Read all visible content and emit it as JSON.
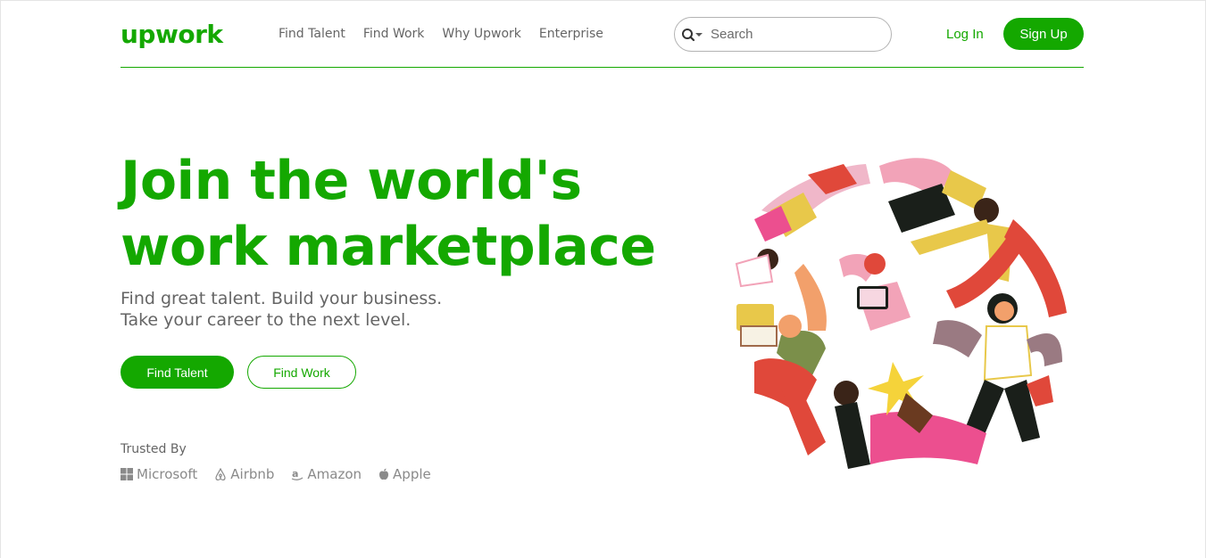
{
  "header": {
    "logo": "upwork",
    "nav": [
      "Find Talent",
      "Find Work",
      "Why Upwork",
      "Enterprise"
    ],
    "search_placeholder": "Search",
    "login": "Log In",
    "signup": "Sign Up"
  },
  "hero": {
    "title_line1": "Join the world's",
    "title_line2": "work marketplace",
    "sub_line1": "Find great talent. Build your business.",
    "sub_line2": "Take your career to the next level.",
    "cta_primary": "Find Talent",
    "cta_secondary": "Find Work"
  },
  "trusted": {
    "label": "Trusted By",
    "brands": [
      {
        "name": "Microsoft",
        "icon": "microsoft-icon"
      },
      {
        "name": "Airbnb",
        "icon": "airbnb-icon"
      },
      {
        "name": "Amazon",
        "icon": "amazon-icon"
      },
      {
        "name": "Apple",
        "icon": "apple-icon"
      }
    ]
  },
  "colors": {
    "brand_green": "#14a800",
    "text_gray": "#656565",
    "logo_gray": "#8a8a8a"
  }
}
